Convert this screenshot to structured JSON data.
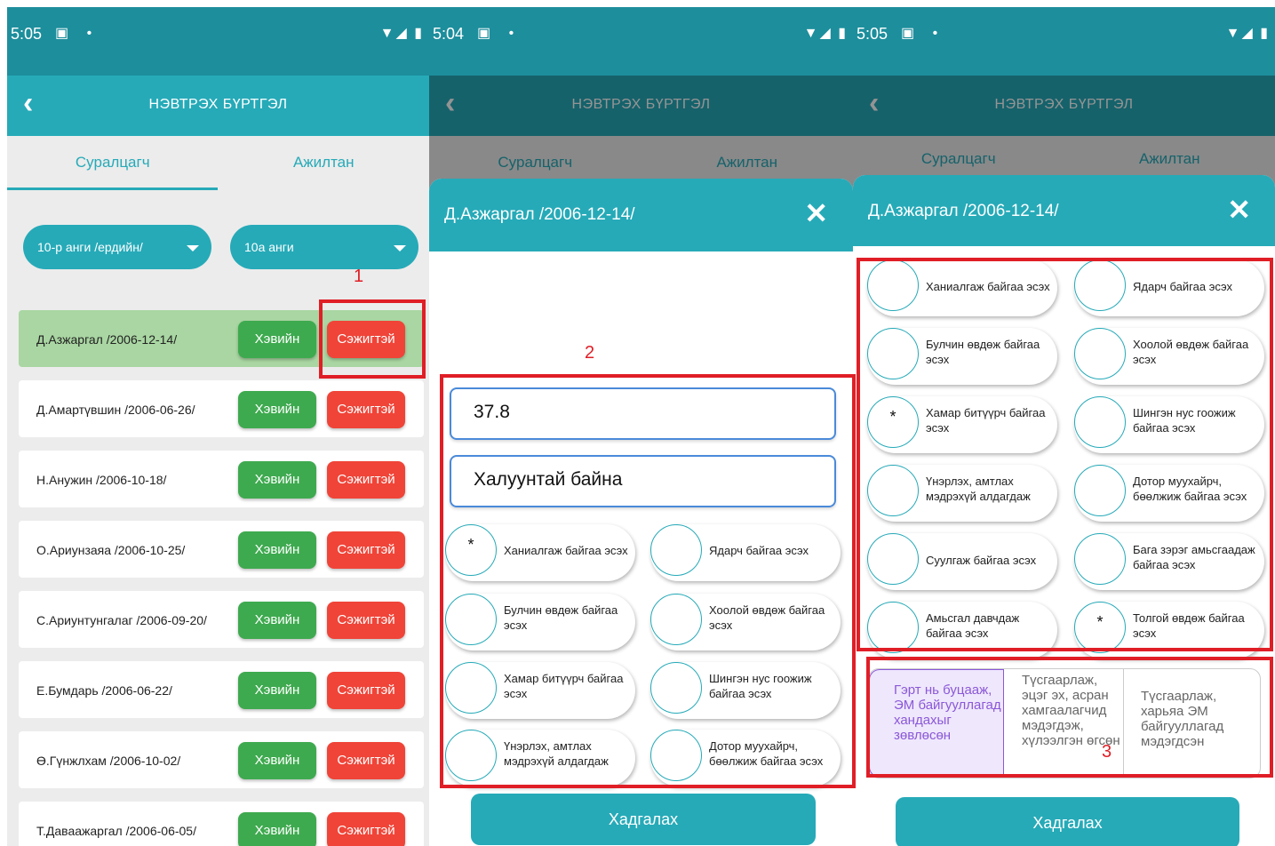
{
  "status_bar": {
    "p1_time": "5:05",
    "p2_time": "5:04",
    "p3_time": "5:05",
    "left_icons": "▣ •",
    "system_icons": "▼◢ ▮"
  },
  "app_bar": {
    "back_icon": "‹",
    "title": "НЭВТРЭХ БҮРТГЭЛ"
  },
  "tabs": {
    "students": "Суралцагч",
    "staff": "Ажилтан"
  },
  "filters": {
    "grade": "10-р анги  /ердийн/",
    "class": "10а анги"
  },
  "student_buttons": {
    "normal": "Хэвийн",
    "suspicious": "Сэжигтэй"
  },
  "students": [
    {
      "name": "Д.Азжаргал /2006-12-14/"
    },
    {
      "name": "Д.Амартүвшин /2006-06-26/"
    },
    {
      "name": "Н.Анужин /2006-10-18/"
    },
    {
      "name": "О.Ариунзаяа /2006-10-25/"
    },
    {
      "name": "С.Ариунтунгалаг /2006-09-20/"
    },
    {
      "name": "Е.Бумдарь /2006-06-22/"
    },
    {
      "name": "Ө.Гүнжлхам /2006-10-02/"
    },
    {
      "name": "Т.Даваажаргал /2006-06-05/"
    }
  ],
  "modal": {
    "title": "Д.Азжаргал /2006-12-14/",
    "close_icon": "✕",
    "temperature_value": "37.8",
    "note_value": "Халуунтай байна",
    "save_label": "Хадгалах"
  },
  "symptoms_p2": [
    {
      "text": "Ханиалгаж байгаа эсэх",
      "mark": "*"
    },
    {
      "text": "Ядарч байгаа эсэх",
      "mark": ""
    },
    {
      "text": "Булчин өвдөж байгаа эсэх",
      "mark": ""
    },
    {
      "text": "Хоолой өвдөж байгаа эсэх",
      "mark": ""
    },
    {
      "text": "Хамар битүүрч байгаа эсэх",
      "mark": ""
    },
    {
      "text": "Шингэн нус гоожиж байгаа эсэх",
      "mark": ""
    },
    {
      "text": "Үнэрлэх, амтлах мэдрэхүй алдагдаж",
      "mark": ""
    },
    {
      "text": "Дотор муухайрч, бөөлжиж байгаа эсэх",
      "mark": ""
    }
  ],
  "symptoms_p3": [
    {
      "text": "Ханиалгаж байгаа эсэх",
      "mark": ""
    },
    {
      "text": "Ядарч байгаа эсэх",
      "mark": ""
    },
    {
      "text": "Булчин өвдөж байгаа эсэх",
      "mark": ""
    },
    {
      "text": "Хоолой өвдөж байгаа эсэх",
      "mark": ""
    },
    {
      "text": "Хамар битүүрч байгаа эсэх",
      "mark": "*"
    },
    {
      "text": "Шингэн нус гоожиж байгаа эсэх",
      "mark": ""
    },
    {
      "text": "Үнэрлэх, амтлах мэдрэхүй алдагдаж",
      "mark": ""
    },
    {
      "text": "Дотор муухайрч, бөөлжиж байгаа эсэх",
      "mark": ""
    },
    {
      "text": "Суулгаж байгаа эсэх",
      "mark": ""
    },
    {
      "text": "Бага зэрэг амьсгаадаж байгаа эсэх",
      "mark": ""
    },
    {
      "text": "Амьсгал давчдаж байгаа эсэх",
      "mark": ""
    },
    {
      "text": "Толгой өвдөж байгаа эсэх",
      "mark": "*"
    }
  ],
  "decision_options": [
    "Гэрт нь буцааж, ЭМ байгууллагад хандахыг зөвлөсөн",
    "Түсгаарлаж, эцэг эх, асран хамгаалагчид мэдэгдэж, хүлээлгэн өгсөн",
    "Түсгаарлаж, харьяа ЭМ байгууллагад мэдэгдсэн"
  ],
  "annotation_labels": [
    "1",
    "2",
    "3"
  ],
  "colors": {
    "primary": "#26aab8",
    "status_bar": "#1d8e9c",
    "normal_button": "#3eaa4f",
    "suspicious_button": "#f04438",
    "annotation": "#e01e26",
    "selected_option": "#8a58d8"
  }
}
